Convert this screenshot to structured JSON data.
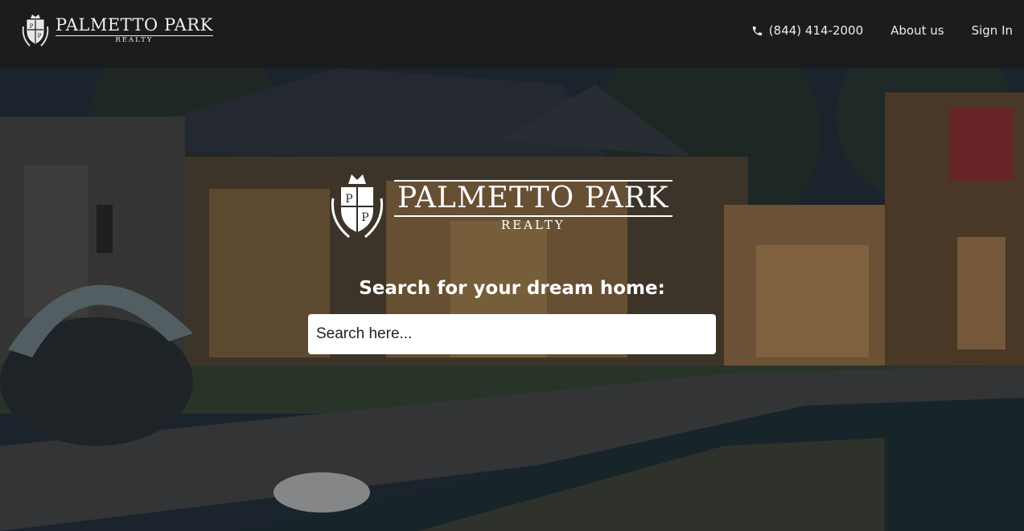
{
  "header": {
    "brand": {
      "name": "PALMETTO PARK",
      "subtitle": "REALTY",
      "icon": "crest-icon"
    },
    "nav": {
      "phone": {
        "icon": "phone-icon",
        "label": "(844) 414-2000"
      },
      "about_label": "About us",
      "signin_label": "Sign In"
    }
  },
  "hero": {
    "logo": {
      "name": "PALMETTO PARK",
      "subtitle": "REALTY",
      "icon": "crest-icon"
    },
    "heading": "Search for your dream home:",
    "search": {
      "placeholder": "Search here...",
      "value": ""
    }
  },
  "colors": {
    "header_bg": "#1b1c1e",
    "text_light": "#ececec",
    "search_bg": "#ffffff"
  }
}
